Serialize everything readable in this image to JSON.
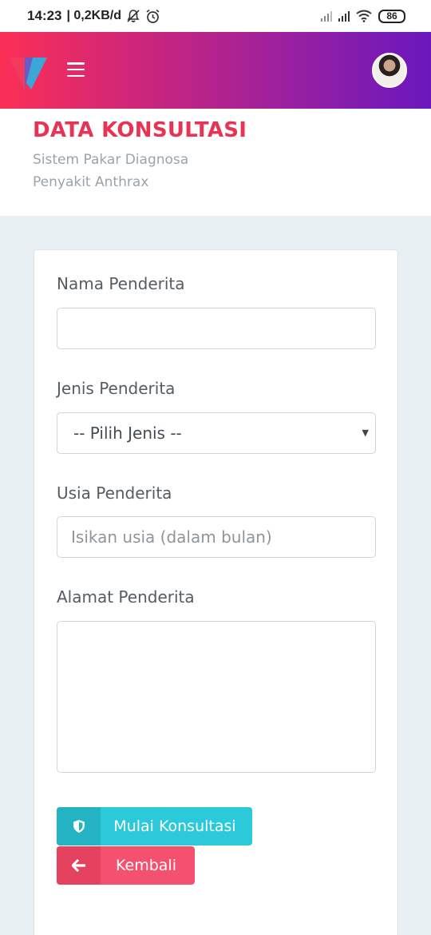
{
  "status_bar": {
    "time": "14:23",
    "network_speed": "| 0,2KB/d",
    "icons": [
      "notifications-muted-icon",
      "alarm-icon",
      "signal-icon",
      "signal-icon",
      "wifi-icon"
    ],
    "battery": "86"
  },
  "header": {
    "logo": "v-logo-icon",
    "menu_icon": "hamburger-menu-icon",
    "avatar": "user-avatar",
    "colors": {
      "gradient_start": "#fb2f55",
      "gradient_end": "#6a17bd"
    }
  },
  "page": {
    "title": "DATA KONSULTASI",
    "subtitle": "Sistem Pakar Diagnosa Penyakit Anthrax",
    "title_color": "#e83354"
  },
  "form": {
    "name": {
      "label": "Nama Penderita",
      "value": "",
      "placeholder": ""
    },
    "type": {
      "label": "Jenis Penderita",
      "selected": "-- Pilih Jenis --"
    },
    "age": {
      "label": "Usia Penderita",
      "value": "",
      "placeholder": "Isikan usia (dalam bulan)"
    },
    "address": {
      "label": "Alamat Penderita",
      "value": ""
    }
  },
  "buttons": {
    "start": {
      "label": "Mulai Konsultasi",
      "icon": "shield-icon",
      "color": "#2bc9da"
    },
    "back": {
      "label": "Kembali",
      "icon": "arrow-left-icon",
      "color": "#f4506f"
    }
  }
}
